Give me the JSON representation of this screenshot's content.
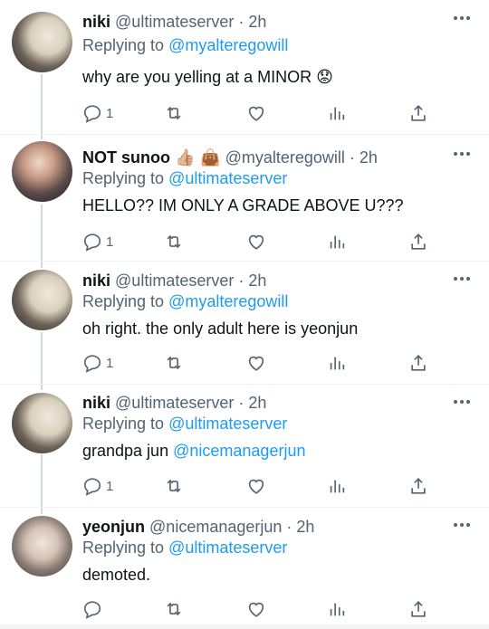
{
  "tweets": [
    {
      "name": "niki",
      "handle": "@ultimateserver",
      "dot": "·",
      "time": "2h",
      "reply_prefix": "Replying to",
      "reply_to": "@myalteregowill",
      "body": "why are you yelling at a MINOR",
      "body_emoji": "😟",
      "reply_count": "1",
      "avatar": "niki"
    },
    {
      "name": "NOT sunoo",
      "name_emoji": "👍🏼 👜",
      "handle": "@myalteregowill",
      "dot": "·",
      "time": "2h",
      "reply_prefix": "Replying to",
      "reply_to": "@ultimateserver",
      "body": "HELLO?? IM ONLY A GRADE ABOVE U???",
      "reply_count": "1",
      "avatar": "sunoo"
    },
    {
      "name": "niki",
      "handle": "@ultimateserver",
      "dot": "·",
      "time": "2h",
      "reply_prefix": "Replying to",
      "reply_to": "@myalteregowill",
      "body": "oh right. the only adult here is yeonjun",
      "reply_count": "1",
      "avatar": "niki"
    },
    {
      "name": "niki",
      "handle": "@ultimateserver",
      "dot": "·",
      "time": "2h",
      "reply_prefix": "Replying to",
      "reply_to": "@ultimateserver",
      "body_prefix": "grandpa jun",
      "body_mention": "@nicemanagerjun",
      "reply_count": "1",
      "avatar": "niki"
    },
    {
      "name": "yeonjun",
      "handle": "@nicemanagerjun",
      "dot": "·",
      "time": "2h",
      "reply_prefix": "Replying to",
      "reply_to": "@ultimateserver",
      "body": "demoted.",
      "reply_count": "",
      "avatar": "yeonjun"
    }
  ],
  "icons": {
    "reply": "reply-icon",
    "retweet": "retweet-icon",
    "like": "heart-icon",
    "views": "views-icon",
    "share": "share-icon",
    "more": "more-icon"
  },
  "colors": {
    "link": "#1d9bf0",
    "muted": "#536471",
    "text": "#0f1419",
    "thread": "#cfd9de"
  }
}
